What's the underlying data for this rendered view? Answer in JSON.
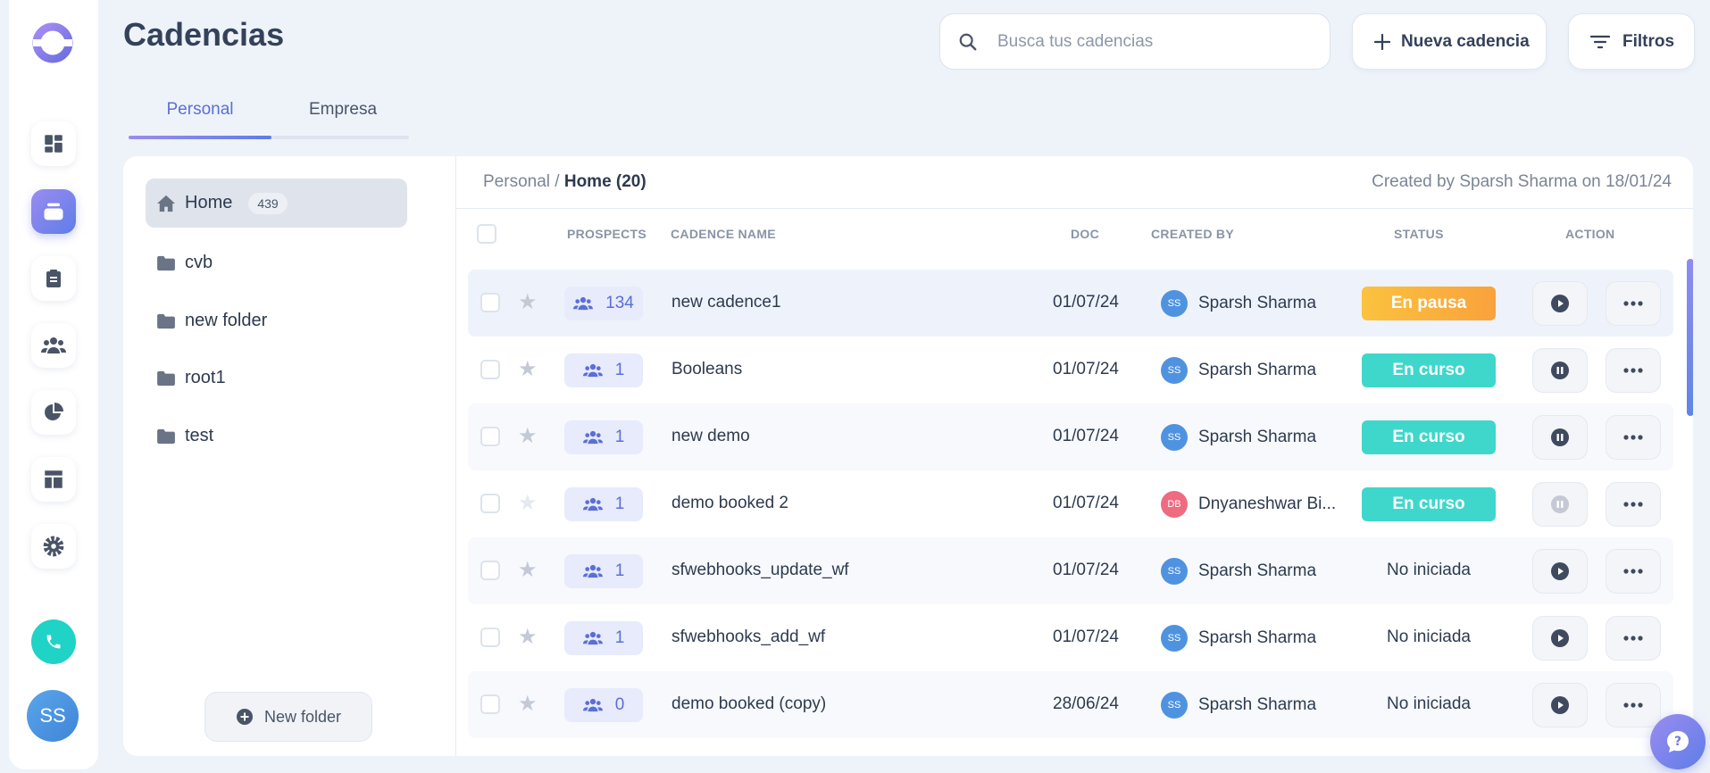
{
  "app": {
    "brand_color": "#7c6de8",
    "logo_icon": "ring-logo"
  },
  "rail": {
    "items": [
      {
        "name": "dashboard",
        "icon": "grid-icon"
      },
      {
        "name": "cadences",
        "icon": "inbox-tray-icon",
        "active": true
      },
      {
        "name": "tasks",
        "icon": "clipboard-icon"
      },
      {
        "name": "contacts",
        "icon": "people-icon"
      },
      {
        "name": "analytics",
        "icon": "pie-chart-icon"
      },
      {
        "name": "templates",
        "icon": "layout-icon"
      },
      {
        "name": "settings",
        "icon": "gear-icon"
      }
    ],
    "phone_icon": "phone-icon",
    "avatar_initials": "SS"
  },
  "header": {
    "title": "Cadencias",
    "search_placeholder": "Busca tus cadencias",
    "new_cadence_label": "Nueva cadencia",
    "filters_label": "Filtros"
  },
  "tabs": [
    {
      "label": "Personal",
      "active": true
    },
    {
      "label": "Empresa",
      "active": false
    }
  ],
  "folders": {
    "items": [
      {
        "label": "Home",
        "count": "439",
        "icon": "home-icon",
        "active": true
      },
      {
        "label": "cvb",
        "icon": "folder-icon"
      },
      {
        "label": "new folder",
        "icon": "folder-icon"
      },
      {
        "label": "root1",
        "icon": "folder-icon"
      },
      {
        "label": "test",
        "icon": "folder-icon"
      }
    ],
    "new_folder_label": "New folder"
  },
  "table": {
    "breadcrumb_parent": "Personal",
    "breadcrumb_separator": "/",
    "breadcrumb_current": "Home (20)",
    "created_note": "Created by Sparsh Sharma on 18/01/24",
    "columns": {
      "prospects": "PROSPECTS",
      "cadence_name": "CADENCE NAME",
      "doc": "DOC",
      "created_by": "CREATED BY",
      "status": "STATUS",
      "action": "ACTION"
    },
    "status_colors": {
      "En pausa": "#fbb33e",
      "En curso": "#3fd7cb"
    },
    "rows": [
      {
        "prospects": "134",
        "name": "new cadence1",
        "doc": "01/07/24",
        "creator": "Sparsh Sharma",
        "creator_initials": "SS",
        "status": "En pausa",
        "action": "play"
      },
      {
        "prospects": "1",
        "name": "Booleans",
        "doc": "01/07/24",
        "creator": "Sparsh Sharma",
        "creator_initials": "SS",
        "status": "En curso",
        "action": "pause"
      },
      {
        "prospects": "1",
        "name": "new demo",
        "doc": "01/07/24",
        "creator": "Sparsh Sharma",
        "creator_initials": "SS",
        "status": "En curso",
        "action": "pause"
      },
      {
        "prospects": "1",
        "name": "demo booked 2",
        "doc": "01/07/24",
        "creator": "Dnyaneshwar Bi...",
        "creator_initials": "DB",
        "status": "En curso",
        "action": "pause-disabled"
      },
      {
        "prospects": "1",
        "name": "sfwebhooks_update_wf",
        "doc": "01/07/24",
        "creator": "Sparsh Sharma",
        "creator_initials": "SS",
        "status": "No iniciada",
        "action": "play"
      },
      {
        "prospects": "1",
        "name": "sfwebhooks_add_wf",
        "doc": "01/07/24",
        "creator": "Sparsh Sharma",
        "creator_initials": "SS",
        "status": "No iniciada",
        "action": "play"
      },
      {
        "prospects": "0",
        "name": "demo booked (copy)",
        "doc": "28/06/24",
        "creator": "Sparsh Sharma",
        "creator_initials": "SS",
        "status": "No iniciada",
        "action": "play"
      }
    ]
  },
  "help_icon": "question-chat-icon"
}
